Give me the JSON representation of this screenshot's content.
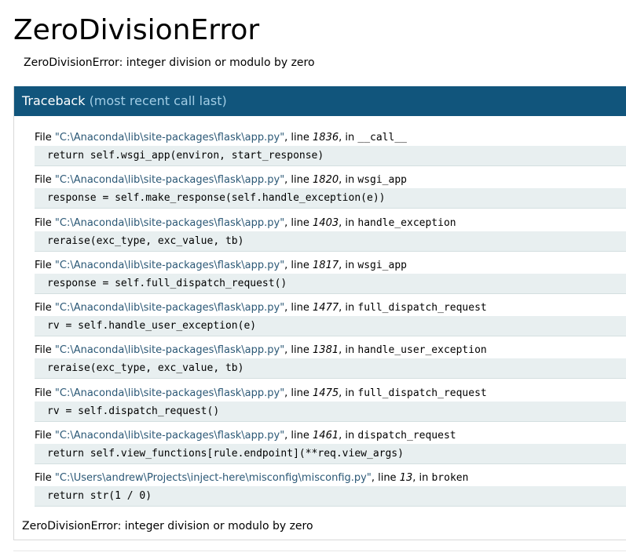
{
  "page": {
    "title": "ZeroDivisionError",
    "message": "ZeroDivisionError: integer division or modulo by zero"
  },
  "traceback": {
    "header": "Traceback",
    "header_sub": "(most recent call last)",
    "file_prefix": "File ",
    "line_prefix": ", line ",
    "in_prefix": ", in ",
    "frames": [
      {
        "filename": "\"C:\\Anaconda\\lib\\site-packages\\flask\\app.py\"",
        "line": "1836",
        "function": "__call__",
        "code": "return self.wsgi_app(environ, start_response)"
      },
      {
        "filename": "\"C:\\Anaconda\\lib\\site-packages\\flask\\app.py\"",
        "line": "1820",
        "function": "wsgi_app",
        "code": "response = self.make_response(self.handle_exception(e))"
      },
      {
        "filename": "\"C:\\Anaconda\\lib\\site-packages\\flask\\app.py\"",
        "line": "1403",
        "function": "handle_exception",
        "code": "reraise(exc_type, exc_value, tb)"
      },
      {
        "filename": "\"C:\\Anaconda\\lib\\site-packages\\flask\\app.py\"",
        "line": "1817",
        "function": "wsgi_app",
        "code": "response = self.full_dispatch_request()"
      },
      {
        "filename": "\"C:\\Anaconda\\lib\\site-packages\\flask\\app.py\"",
        "line": "1477",
        "function": "full_dispatch_request",
        "code": "rv = self.handle_user_exception(e)"
      },
      {
        "filename": "\"C:\\Anaconda\\lib\\site-packages\\flask\\app.py\"",
        "line": "1381",
        "function": "handle_user_exception",
        "code": "reraise(exc_type, exc_value, tb)"
      },
      {
        "filename": "\"C:\\Anaconda\\lib\\site-packages\\flask\\app.py\"",
        "line": "1475",
        "function": "full_dispatch_request",
        "code": "rv = self.dispatch_request()"
      },
      {
        "filename": "\"C:\\Anaconda\\lib\\site-packages\\flask\\app.py\"",
        "line": "1461",
        "function": "dispatch_request",
        "code": "return self.view_functions[rule.endpoint](**req.view_args)"
      },
      {
        "filename": "\"C:\\Users\\andrew\\Projects\\inject-here\\misconfig\\misconfig.py\"",
        "line": "13",
        "function": "broken",
        "code": "return str(1 / 0)"
      }
    ],
    "final_error": "ZeroDivisionError: integer division or modulo by zero"
  },
  "colors": {
    "header_background": "#11557c",
    "header_text": "#ffffff",
    "header_subtext": "#a2cde5",
    "filename_text": "#2b5876",
    "code_background": "#e8eff0"
  }
}
